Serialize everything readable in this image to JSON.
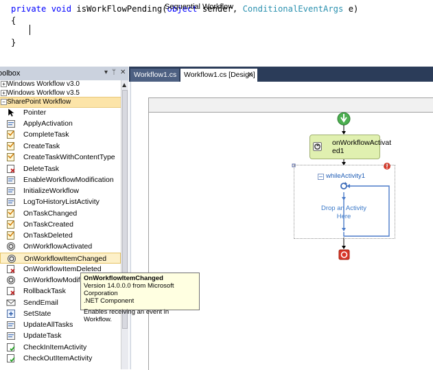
{
  "code": {
    "line1_kw1": "private",
    "line1_kw2": "void",
    "line1_method": "isWorkFlowPending(",
    "line1_kw3": "object",
    "line1_p1": "sender,",
    "line1_type": "ConditionalEventArgs",
    "line1_p2": "e)",
    "line2": "{",
    "line3": "}"
  },
  "toolbox": {
    "title": "oolbox",
    "pin_glyph": "▾ ⊥ ✕",
    "categories": [
      {
        "label": "Windows Workflow v3.0",
        "expander": "+"
      },
      {
        "label": "Windows Workflow v3.5",
        "expander": "+"
      },
      {
        "label": "SharePoint Workflow",
        "expander": "−"
      }
    ],
    "items": [
      {
        "label": "Pointer",
        "icon": "pointer-icon"
      },
      {
        "label": "ApplyActivation",
        "icon": "apply-activation-icon"
      },
      {
        "label": "CompleteTask",
        "icon": "complete-task-icon"
      },
      {
        "label": "CreateTask",
        "icon": "create-task-icon"
      },
      {
        "label": "CreateTaskWithContentType",
        "icon": "create-task-content-icon"
      },
      {
        "label": "DeleteTask",
        "icon": "delete-task-icon"
      },
      {
        "label": "EnableWorkflowModification",
        "icon": "enable-modification-icon"
      },
      {
        "label": "InitializeWorkflow",
        "icon": "initialize-workflow-icon"
      },
      {
        "label": "LogToHistoryListActivity",
        "icon": "log-history-icon"
      },
      {
        "label": "OnTaskChanged",
        "icon": "task-changed-icon"
      },
      {
        "label": "OnTaskCreated",
        "icon": "task-created-icon"
      },
      {
        "label": "OnTaskDeleted",
        "icon": "task-deleted-icon"
      },
      {
        "label": "OnWorkflowActivated",
        "icon": "workflow-activated-icon"
      },
      {
        "label": "OnWorkflowItemChanged",
        "icon": "item-changed-icon"
      },
      {
        "label": "OnWorkflowItemDeleted",
        "icon": "item-deleted-icon"
      },
      {
        "label": "OnWorkflowModified",
        "icon": "workflow-modified-icon"
      },
      {
        "label": "RollbackTask",
        "icon": "rollback-icon"
      },
      {
        "label": "SendEmail",
        "icon": "send-email-icon"
      },
      {
        "label": "SetState",
        "icon": "set-state-icon"
      },
      {
        "label": "UpdateAllTasks",
        "icon": "update-all-icon"
      },
      {
        "label": "UpdateTask",
        "icon": "update-task-icon"
      },
      {
        "label": "CheckInItemActivity",
        "icon": "check-in-icon"
      },
      {
        "label": "CheckOutItemActivity",
        "icon": "check-out-icon"
      }
    ]
  },
  "tooltip": {
    "title": "OnWorkflowItemChanged",
    "line1": "Version 14.0.0.0 from Microsoft Corporation",
    "line2": ".NET Component",
    "line3": "Enables receiving an event in Workflow."
  },
  "tabs": [
    {
      "label": "Workflow1.cs"
    },
    {
      "label": "Workflow1.cs [Design]",
      "close": "✕"
    }
  ],
  "designer": {
    "title": "Sequential Workflow",
    "activity_line1": "onWorkflowActivat",
    "activity_line2": "ed1",
    "while_title": "whileActivity1",
    "while_expander": "−",
    "drop_line1": "Drop an Activity",
    "drop_line2": "Here"
  },
  "colors": {
    "tab_bar": "#2b3c59",
    "selection": "#fdf0c8",
    "activity": "#e0f0b0",
    "start": "#4caf50",
    "end": "#d9372a",
    "error": "#d63b2b"
  }
}
